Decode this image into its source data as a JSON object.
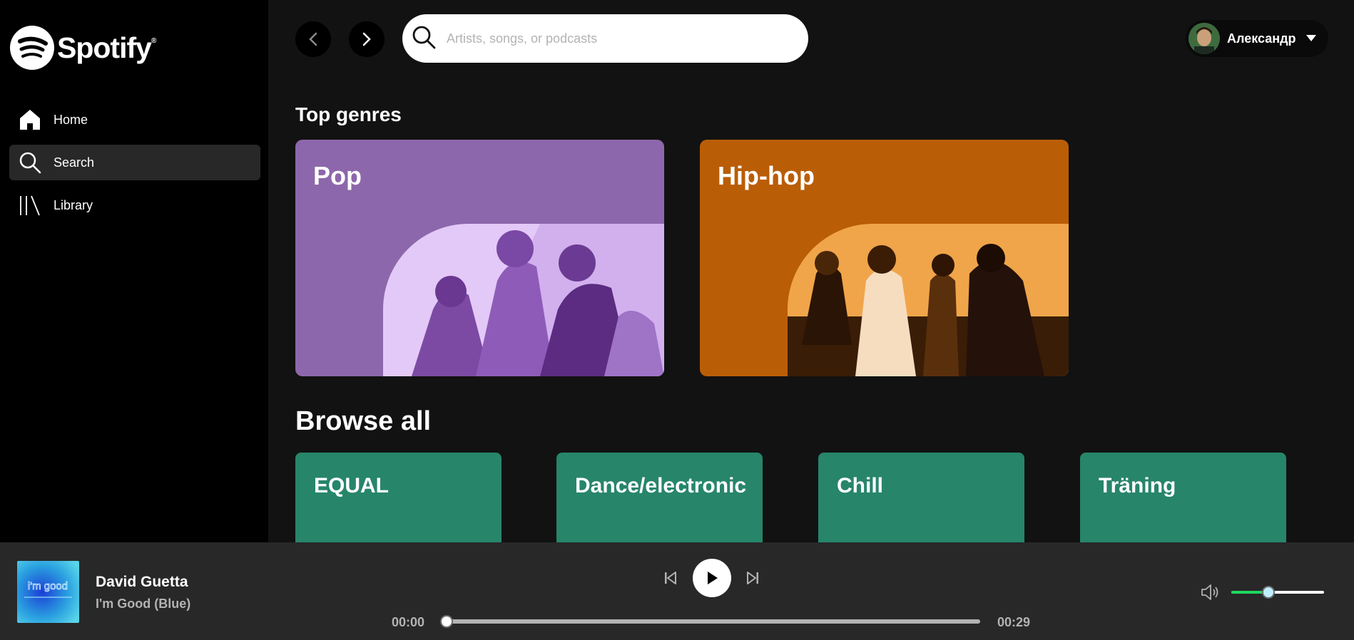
{
  "brand": {
    "name": "Spotify",
    "trademark": "®"
  },
  "sidebar": {
    "items": [
      {
        "label": "Home",
        "icon": "home-icon",
        "active": false
      },
      {
        "label": "Search",
        "icon": "search-icon",
        "active": true
      },
      {
        "label": "Library",
        "icon": "library-icon",
        "active": false
      }
    ]
  },
  "search": {
    "placeholder": "Artists, songs, or podcasts",
    "value": ""
  },
  "user": {
    "name": "Александр"
  },
  "top_genres": {
    "title": "Top genres",
    "cards": [
      {
        "label": "Pop",
        "color": "#8d67ab"
      },
      {
        "label": "Hip-hop",
        "color": "#ba5d07"
      }
    ]
  },
  "browse_all": {
    "title": "Browse all",
    "cards": [
      {
        "label": "EQUAL",
        "color": "#27856a"
      },
      {
        "label": "Dance/electronic",
        "color": "#27856a"
      },
      {
        "label": "Chill",
        "color": "#27856a"
      },
      {
        "label": "Träning",
        "color": "#27856a"
      }
    ]
  },
  "player": {
    "artist": "David Guetta",
    "title": "I'm Good (Blue)",
    "elapsed": "00:00",
    "total": "00:29",
    "progress": 0.0,
    "volume": 0.4,
    "cover_text": "i'm good"
  },
  "colors": {
    "accent": "#1ed760",
    "background": "#121212",
    "sidebar": "#000000",
    "player": "#282828"
  }
}
